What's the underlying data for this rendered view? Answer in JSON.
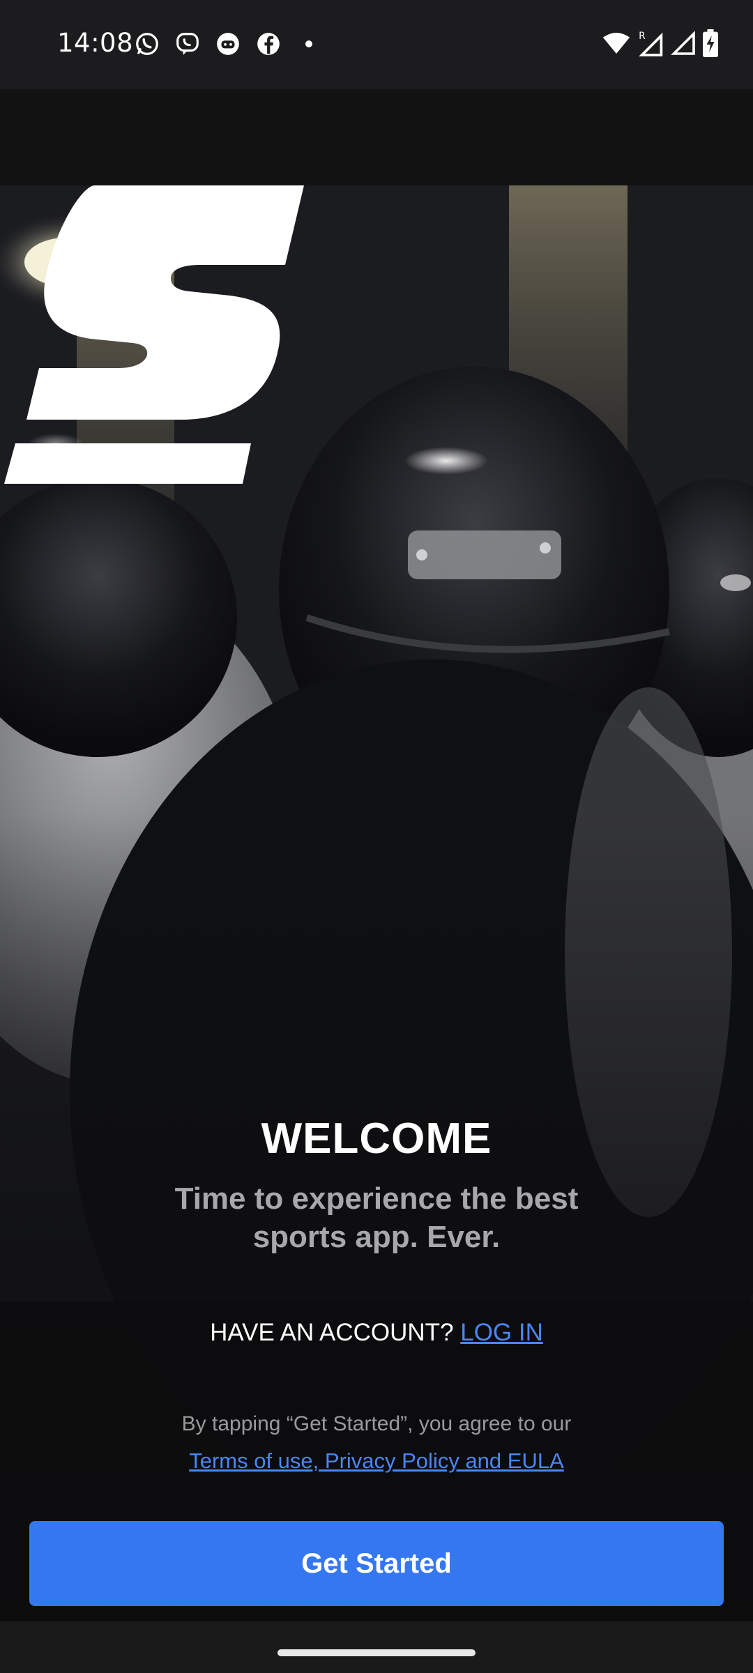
{
  "status_bar": {
    "time": "14:08",
    "notification_icons": [
      "whatsapp-icon",
      "viber-icon",
      "app-icon",
      "facebook-icon",
      "dot-icon"
    ],
    "system_icons": [
      "wifi-icon",
      "signal-roaming-icon",
      "signal-icon",
      "battery-charging-icon"
    ],
    "roaming_indicator": "R"
  },
  "welcome": {
    "title": "WELCOME",
    "tagline": "Time to experience the best sports app. Ever.",
    "account_prompt": "HAVE AN ACCOUNT?",
    "login_label": "LOG IN"
  },
  "legal": {
    "text": "By tapping “Get Started”, you agree to our",
    "link_label": "Terms of use, Privacy Policy and EULA"
  },
  "actions": {
    "get_started_label": "Get Started"
  },
  "colors": {
    "accent": "#3577f0",
    "link": "#4a86f5",
    "background": "#0e0e0f"
  }
}
